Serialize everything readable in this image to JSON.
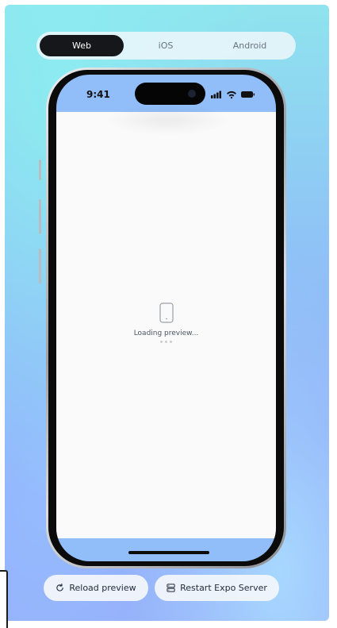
{
  "platform_tabs": [
    {
      "label": "Web",
      "active": true
    },
    {
      "label": "iOS",
      "active": false
    },
    {
      "label": "Android",
      "active": false
    }
  ],
  "phone": {
    "status_time": "9:41",
    "loading_text": "Loading preview..."
  },
  "actions": {
    "reload_label": "Reload preview",
    "restart_label": "Restart Expo Server"
  },
  "colors": {
    "active_tab": "#16171a",
    "panel_top": "#8fe3ee",
    "panel_bottom": "#96aaf8"
  },
  "icons": [
    "phone-outline-icon",
    "signal-icon",
    "wifi-icon",
    "battery-icon",
    "reload-icon",
    "server-icon"
  ]
}
